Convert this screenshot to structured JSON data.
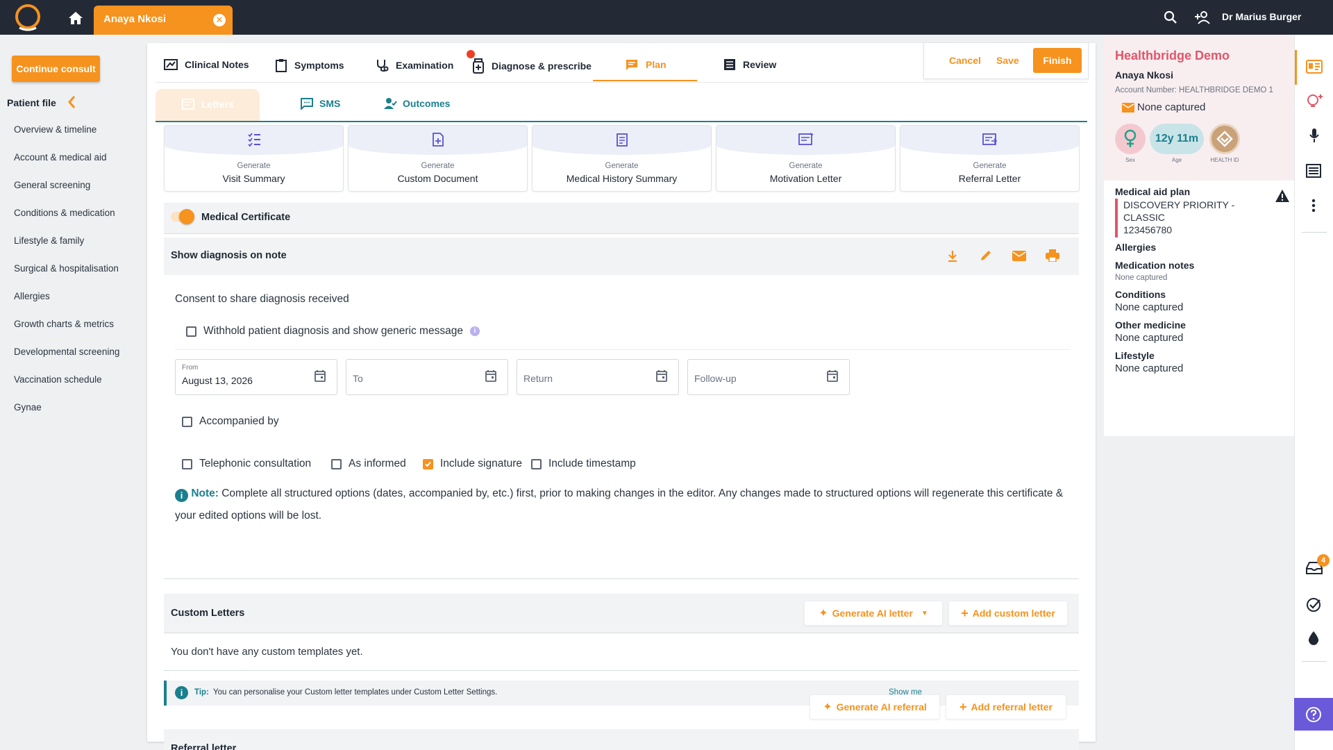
{
  "topbar": {
    "patient_tab": "Anaya Nkosi",
    "doctor_name": "Dr Marius Burger",
    "icons": [
      "app-logo",
      "home-icon",
      "close-icon",
      "search-icon",
      "add-person-icon"
    ]
  },
  "leftnav": {
    "continue_label": "Continue consult",
    "patient_file_label": "Patient file",
    "items": [
      "Overview & timeline",
      "Account & medical aid",
      "General screening",
      "Conditions & medication",
      "Lifestyle & family",
      "Surgical & hospitalisation",
      "Allergies",
      "Growth charts & metrics",
      "Developmental screening",
      "Vaccination schedule",
      "Gynae"
    ]
  },
  "tabs": {
    "items": [
      "Clinical Notes",
      "Symptoms",
      "Examination",
      "Diagnose & prescribe",
      "Plan",
      "Review"
    ],
    "active": "Plan",
    "cancel": "Cancel",
    "save": "Save",
    "finish": "Finish"
  },
  "subtabs": {
    "items": [
      "Letters",
      "SMS",
      "Outcomes"
    ],
    "active": "Letters"
  },
  "generate": {
    "prefix": "Generate",
    "cards": [
      "Visit Summary",
      "Custom Document",
      "Medical History Summary",
      "Motivation Letter",
      "Referral Letter"
    ]
  },
  "certificate": {
    "title": "Medical Certificate",
    "toggle_on": true,
    "show_diagnosis": "Show diagnosis on note",
    "consent": "Consent to share diagnosis received",
    "withhold": "Withhold patient diagnosis and show generic message",
    "from_label": "From",
    "from_value": "August 13, 2026",
    "to_label": "To",
    "return_label": "Return",
    "followup_label": "Follow-up",
    "accompanied": "Accompanied by",
    "telephonic": "Telephonic consultation",
    "as_informed": "As informed",
    "include_signature": "Include signature",
    "include_signature_checked": true,
    "include_timestamp": "Include timestamp",
    "note_label": "Note:",
    "note_text": "Complete all structured options (dates, accompanied by, etc.) first, prior to making changes in the editor. Any changes made to structured options will regenerate this certificate & your edited options will be lost."
  },
  "custom_letters": {
    "title": "Custom Letters",
    "generate_ai": "Generate AI letter",
    "add": "Add custom letter",
    "empty": "You don't have any custom templates yet.",
    "tip_label": "Tip:",
    "tip_text": "You can personalise your Custom letter templates under Custom Letter Settings.",
    "show_me": "Show me"
  },
  "referral": {
    "title": "Referral letter",
    "generate_ai": "Generate AI referral",
    "add": "Add referral letter"
  },
  "patient_panel": {
    "practice": "Healthbridge Demo",
    "patient_name": "Anaya Nkosi",
    "account": "Account Number: HEALTHBRIDGE DEMO 1",
    "email_status": "None captured",
    "age": "12y 11m",
    "sex_label": "Sex",
    "age_label": "Age",
    "health_id_label": "HEALTH ID",
    "medical_aid_title": "Medical aid plan",
    "medical_aid_line1": "DISCOVERY PRIORITY -",
    "medical_aid_line2": "CLASSIC",
    "medical_aid_number": "123456780",
    "allergies_title": "Allergies",
    "med_notes_title": "Medication notes",
    "med_notes_value": "None captured",
    "conditions_title": "Conditions",
    "conditions_value": "None captured",
    "other_med_title": "Other medicine",
    "other_med_value": "None captured",
    "lifestyle_title": "Lifestyle",
    "lifestyle_value": "None captured"
  },
  "rightbar": {
    "badge_count": "4"
  },
  "colors": {
    "accent": "#f6921e",
    "teal": "#1a7f8e",
    "topbar": "#232a36",
    "practice": "#e0566a",
    "help": "#6a59d9"
  }
}
